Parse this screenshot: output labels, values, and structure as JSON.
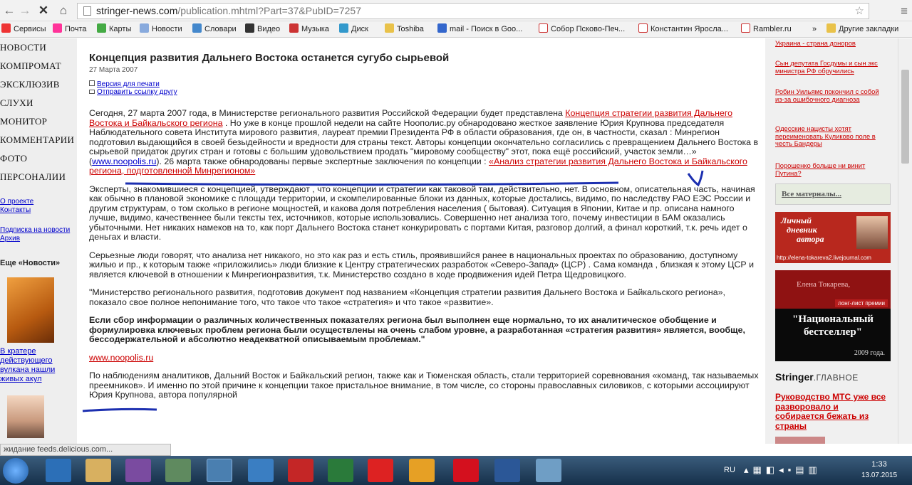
{
  "browser": {
    "url_host": "stringer-news.com",
    "url_path": "/publication.mhtml?Part=37&PubID=7257",
    "bookmarks": [
      "Сервисы",
      "Почта",
      "Карты",
      "Новости",
      "Словари",
      "Видео",
      "Музыка",
      "Диск",
      "Toshiba",
      "mail - Поиск в Goo...",
      "Собор Псково-Печ...",
      "Константин Яросла...",
      "Rambler.ru",
      "»",
      "Другие закладки"
    ]
  },
  "nav": {
    "items": [
      "НОВОСТИ",
      "КОМПРОМАТ",
      "ЭКСКЛЮЗИВ",
      "СЛУХИ",
      "МОНИТОР",
      "КОММЕНТАРИИ",
      "ФОТО",
      "ПЕРСОНАЛИИ"
    ],
    "about": "О проекте",
    "contacts": "Контакты",
    "subscribe": "Подписка на новости",
    "archive": "Архив",
    "more_news": "Еще «Новости»",
    "news_caption": "В кратере действующего вулкана нашли живых акул"
  },
  "article": {
    "title": "Концепция развития Дальнего Востока останется сугубо сырьевой",
    "date": "27 Марта 2007",
    "print": "Версия для печати",
    "send": "Отправить ссылку другу",
    "p1a": "Сегодня, 27 марта 2007 года, в Министерстве регионального развития Российской Федерации будет представлена ",
    "p1link": "Концепция стратегии развития Дальнего Востока и Байкальского региона",
    "p1b": " . Но уже в конце прошлой недели на сайте Ноополис.ру обнародовано жесткое заявление Юрия Крупнова председателя Наблюдательного совета Института мирового развития, лауреат премии Президента РФ в области образования, где он, в частности, сказал : Минрегион подготовил выдающийся в своей безыдейности и вредности для страны текст. Авторы концепции окончательно согласились с превращением Дальнего Востока в сырьевой придаток других стран и готовы с большим удовольствием продать \"мировому сообществу\" этот, пока ещё российский, участок земли…» (",
    "p1site": "www.noopolis.ru",
    "p1c": "). 26 марта также обнародованы первые экспертные заключения по концепции : ",
    "p1link2": "«Анализ стратегии развития Дальнего Востока и Байкальского региона, подготовленной Минрегионом»",
    "p2": "Эксперты, знакомившиеся с концепцией, утверждают , что концепции и стратегии как таковой там, действительно, нет. В основном, описательная часть, начиная как обычно в плановой экономике с площади территории, и скомпелированные блоки из данных, которые достались, видимо, по наследству РАО ЕЭС России и другим структурам, о том сколько в регионе мощностей, и какова доля потребления населения ( бытовая). Ситуация в Японии, Китае и пр. описана намного лучше, видимо, качественнее были тексты тех, источников, которые использовались. Совершенно нет анализа того, почему инвестиции в БАМ оказались убыточными. Нет никаких намеков на то, как порт Дальнего Востока станет конкурировать с портами Китая, разговор долгий, а финал короткий, т.к. речь идет о деньгах и власти.",
    "p3": "Серьезные люди говорят, что анализа нет никакого, но это как раз и есть стиль, проявившийся ранее в национальных проектах по образованию, доступному жилью и пр., к которым также «приложились» люди близкие к Центру стратегических разработок «Северо-Запад» (ЦСР) . Сама команда , близкая к этому ЦСР и является ключевой в отношении к Минрегионразвития, т.к. Министерство создано в ходе продвижения идей Петра Щедровицкого.",
    "p4": "\"Министерство регионального развития, подготовив документ под названием «Концепция стратегии развития Дальнего Востока и Байкальского региона», показало свое полное непонимание того, что такое что такое «стратегия» и что такое «развитие».",
    "p5": "Если сбор информации о различных количественных показателях региона был выполнен еще нормально, то их аналитическое обобщение и формулировка ключевых проблем региона были осуществлены на очень слабом уровне, а разработанная «стратегия развития» является, вообще, бессодержательной и абсолютно неадекватной описываемым проблемам.\"",
    "p6": "www.noopolis.ru",
    "p7": "По наблюдениям аналитиков, Дальний Восток и Байкальский регион, также как и Тюменская область, стали территорией соревнования «команд, так называемых преемников». И именно по этой причине к концепции такое пристальное внимание, в том числе, со стороны православных силовиков, с которыми ассоциируют Юрия Крупнова, автора популярной"
  },
  "right": {
    "links": [
      "Украина - страна доноров",
      "Сын депутата Госдумы и сын экс министра РФ обручились",
      "Робин Уильямс покончил с собой из-за ошибочного диагноза",
      "Одесские нацисты хотят переименовать Куликово поле в честь Бандеры",
      "Порошенко больше ни винит Путина?"
    ],
    "all": "Все матерналы...",
    "diary1": "Личный",
    "diary2": "дневник",
    "diary3": "автора",
    "diary_url": "http://elena-tokareva2.livejournal.com",
    "ad_name": "Елена Токарева,",
    "ad_tag": "лонг-лист премии",
    "ad_title": "\"Национальный бестселлер\"",
    "ad_year": "2009 года.",
    "brand": "Stringer",
    "brand_sub": ".ГЛАВНОЕ",
    "main_link": "Руководство МТС уже все разворовало и собирается бежать из страны"
  },
  "status": "жидание feeds.delicious.com...",
  "tray": {
    "lang": "RU",
    "time": "1:33",
    "date": "13.07.2015"
  }
}
